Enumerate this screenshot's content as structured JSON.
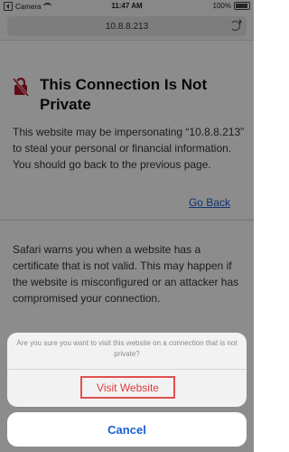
{
  "status_bar": {
    "carrier": "Camera",
    "time": "11:47 AM",
    "battery": "100%"
  },
  "url_bar": {
    "url": "10.8.8.213",
    "reload_icon": "reload-icon"
  },
  "warning": {
    "icon": "lock-slash-icon",
    "title": "This Connection Is Not Private",
    "paragraph1": "This website may be impersonating “10.8.8.213” to steal your personal or financial information. You should go back to the previous page.",
    "go_back": "Go Back",
    "paragraph2": "Safari warns you when a website has a certificate that is not valid. This may happen if the website is misconfigured or an attacker has compromised your connection."
  },
  "action_sheet": {
    "message": "Are you sure you want to visit this website on a connection that is not private?",
    "visit_label": "Visit Website",
    "cancel_label": "Cancel"
  },
  "colors": {
    "link": "#1a5fd1",
    "destructive": "#e23a3a",
    "highlight_border": "#e25050",
    "lock_icon": "#b5122b"
  }
}
